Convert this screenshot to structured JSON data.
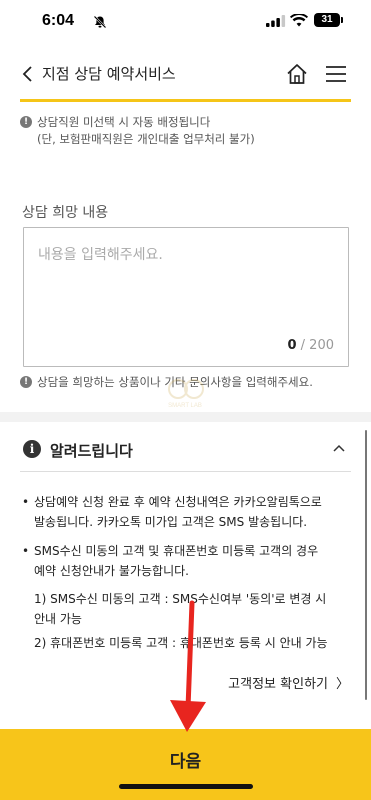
{
  "status": {
    "time": "6:04",
    "battery": "31"
  },
  "header": {
    "title": "지점 상담 예약서비스"
  },
  "notes": {
    "staff_line1": "상담직원 미선택 시 자동 배정됩니다",
    "staff_line2": "(단, 보험판매직원은 개인대출 업무처리 불가)",
    "content_hint": "상담을 희망하는 상품이나 기타 문의사항을 입력해주세요."
  },
  "request": {
    "label": "상담 희망 내용",
    "placeholder": "내용을 입력해주세요.",
    "count_current": "0",
    "count_max": "/ 200"
  },
  "notice": {
    "title": "알려드립니다",
    "bullets": [
      {
        "line1": "상담예약 신청 완료 후 예약 신청내역은 카카오알림톡으로",
        "line2": "발송됩니다. 카카오톡 미가입 고객은 SMS 발송됩니다."
      },
      {
        "line1": "SMS수신 미동의 고객 및 휴대폰번호 미등록 고객의 경우",
        "line2": "예약 신청안내가 불가능합니다."
      }
    ],
    "subs": [
      {
        "line1": "1) SMS수신 미동의 고객 : SMS수신여부 '동의'로 변경 시",
        "line2": "안내 가능"
      },
      {
        "line1": "2) 휴대폰번호 미등록 고객 : 휴대폰번호 등록 시 안내 가능"
      }
    ],
    "customer_link": "고객정보 확인하기"
  },
  "footer": {
    "next_label": "다음"
  },
  "colors": {
    "accent": "#f7c51a",
    "annotation_arrow": "#e8251f"
  },
  "icons": [
    "bell-off-icon",
    "signal-icon",
    "wifi-icon",
    "battery-icon",
    "back-arrow-icon",
    "home-icon",
    "hamburger-menu-icon",
    "info-icon",
    "chevron-up-icon",
    "chevron-right-icon"
  ]
}
